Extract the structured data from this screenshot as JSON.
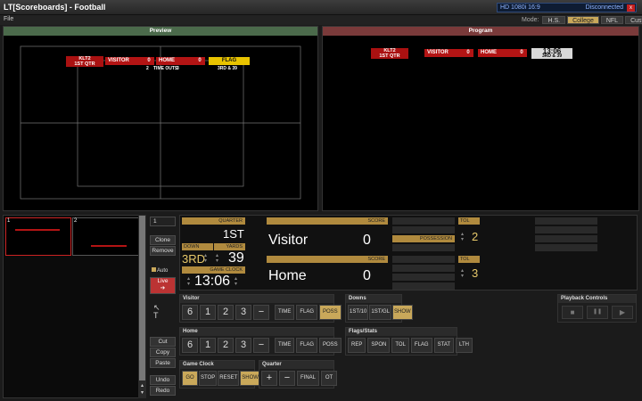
{
  "window": {
    "title": "LT[Scoreboards] - Football",
    "format": "HD 1080i 16:9",
    "status": "Disconnected",
    "close_glyph": "x"
  },
  "menu": {
    "file": "File"
  },
  "mode": {
    "label": "Mode:",
    "options": [
      "H.S.",
      "College",
      "NFL",
      "Custom"
    ],
    "selected": "College"
  },
  "preview": {
    "header": "Preview",
    "bug": {
      "logo_top": "KLT2",
      "logo_bottom": "1ST QTR",
      "visitor": "VISITOR",
      "visitor_score": "0",
      "home": "HOME",
      "home_score": "0",
      "flag": "FLAG",
      "flag_sub": "3RD & 39",
      "time_outs_label": "TIME OUTS",
      "visitor_timeouts": "2",
      "home_timeouts": "3"
    }
  },
  "program": {
    "header": "Program",
    "bug": {
      "logo_top": "KLT2",
      "logo_bottom": "1ST QTR",
      "visitor": "VISITOR",
      "visitor_score": "0",
      "home": "HOME",
      "home_score": "0",
      "clock": "13:06",
      "clock_sub": "3RD & 39"
    }
  },
  "playlist": {
    "items": [
      {
        "num": "1"
      },
      {
        "num": "2"
      }
    ],
    "index": "1"
  },
  "side_buttons": {
    "clone": "Clone",
    "remove": "Remove",
    "auto": "Auto",
    "live": "Live",
    "live_arrow": "➔",
    "cut": "Cut",
    "copy": "Copy",
    "paste": "Paste",
    "undo": "Undo",
    "redo": "Redo"
  },
  "scoreboard": {
    "quarter_label": "QUARTER",
    "quarter": "1ST",
    "down_label": "DOWN",
    "down": "3RD",
    "yards_label": "YARDS",
    "yards": "39",
    "game_clock_label": "GAME CLOCK",
    "clock": "13:06",
    "score_label": "SCORE",
    "visitor_name": "Visitor",
    "visitor_score": "0",
    "home_name": "Home",
    "home_score": "0",
    "possession_label": "POSSESSION",
    "tol_label": "TOL",
    "visitor_tol": "2",
    "home_tol": "3"
  },
  "visitor_group": {
    "label": "Visitor",
    "nums": [
      "6",
      "1",
      "2",
      "3"
    ],
    "minus": "−",
    "time": "TIME",
    "flag": "FLAG",
    "poss": "POSS"
  },
  "home_group": {
    "label": "Home",
    "nums": [
      "6",
      "1",
      "2",
      "3"
    ],
    "minus": "−",
    "time": "TIME",
    "flag": "FLAG",
    "poss": "POSS"
  },
  "downs_group": {
    "label": "Downs",
    "first_10": "1ST/10",
    "first_gl": "1ST/GL",
    "show": "SHOW"
  },
  "flags_group": {
    "label": "Flags/Stats",
    "buttons": [
      "REP",
      "SPON",
      "TOL",
      "FLAG",
      "STAT",
      "LTH"
    ]
  },
  "clock_group": {
    "label": "Game Clock",
    "go": "GO",
    "stop": "STOP",
    "reset": "RESET",
    "show": "SHOW"
  },
  "quarter_group": {
    "label": "Quarter",
    "plus": "+",
    "minus": "−",
    "final": "FINAL",
    "ot": "OT"
  },
  "playback": {
    "label": "Playback Controls",
    "stop": "■",
    "pause": "❚❚",
    "play": "▶"
  },
  "colors": {
    "accent_gold": "#c9a85a",
    "bug_red": "#b31414",
    "flag_yellow": "#e8c300",
    "preview_green": "#4b6a4b",
    "program_red": "#7a3a3a"
  }
}
